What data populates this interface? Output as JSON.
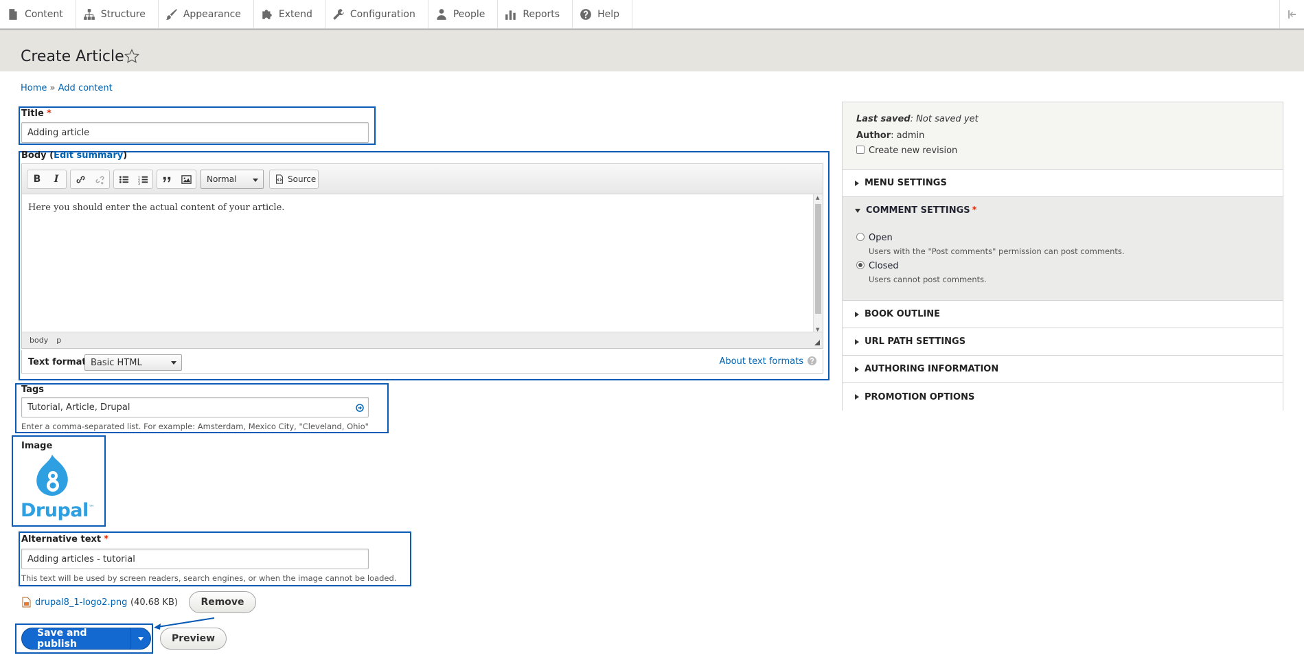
{
  "toolbar": {
    "items": [
      {
        "label": "Content",
        "icon": "file-icon"
      },
      {
        "label": "Structure",
        "icon": "sitemap-icon"
      },
      {
        "label": "Appearance",
        "icon": "paintbrush-icon"
      },
      {
        "label": "Extend",
        "icon": "puzzle-icon"
      },
      {
        "label": "Configuration",
        "icon": "wrench-icon"
      },
      {
        "label": "People",
        "icon": "person-icon"
      },
      {
        "label": "Reports",
        "icon": "chart-icon"
      },
      {
        "label": "Help",
        "icon": "help-icon"
      }
    ]
  },
  "header": {
    "title": "Create Article"
  },
  "breadcrumb": {
    "home": "Home",
    "separator": "»",
    "current": "Add content"
  },
  "form": {
    "title": {
      "label": "Title",
      "required": "*",
      "value": "Adding article"
    },
    "body": {
      "label": "Body (",
      "edit_summary": "Edit summary",
      "label_close": ")",
      "format_select": "Normal",
      "source_label": "Source",
      "content": "Here you should enter the actual content of your article.",
      "path": [
        "body",
        "p"
      ],
      "text_format_label": "Text format",
      "text_format_value": "Basic HTML",
      "about_formats": "About text formats"
    },
    "tags": {
      "label": "Tags",
      "value": "Tutorial, Article, Drupal",
      "description": "Enter a comma-separated list. For example: Amsterdam, Mexico City, \"Cleveland, Ohio\""
    },
    "image": {
      "label": "Image",
      "logo_text": "Drupal",
      "tm": "™"
    },
    "alt_text": {
      "label": "Alternative text",
      "required": "*",
      "value": "Adding articles - tutorial",
      "description": "This text will be used by screen readers, search engines, or when the image cannot be loaded."
    },
    "file": {
      "name": "drupal8_1-logo2.png",
      "size": "(40.68 KB)",
      "remove_label": "Remove"
    },
    "actions": {
      "save_label": "Save and publish",
      "preview_label": "Preview"
    }
  },
  "sidebar": {
    "last_saved_label": "Last saved",
    "last_saved_value": ": Not saved yet",
    "author_label": "Author",
    "author_value": ": admin",
    "revision_label": "Create new revision",
    "sections": {
      "menu": "MENU SETTINGS",
      "comment": "COMMENT SETTINGS",
      "book": "BOOK OUTLINE",
      "url": "URL PATH SETTINGS",
      "authoring": "AUTHORING INFORMATION",
      "promotion": "PROMOTION OPTIONS"
    },
    "comment_required": "*",
    "comment_options": {
      "open_label": "Open",
      "open_desc": "Users with the \"Post comments\" permission can post comments.",
      "closed_label": "Closed",
      "closed_desc": "Users cannot post comments."
    }
  },
  "colors": {
    "accent": "#1369cf",
    "highlight": "#0a5bb5",
    "required": "#e62600",
    "link": "#0064b3"
  }
}
